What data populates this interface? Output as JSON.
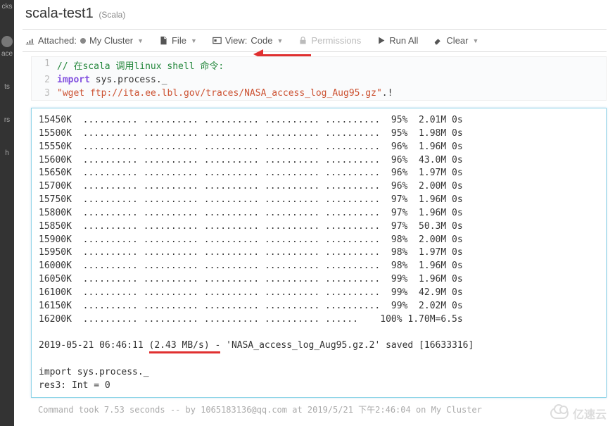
{
  "sidebar": {
    "items": [
      "cks",
      "",
      "ace",
      "ts",
      "",
      "rs",
      "h"
    ]
  },
  "header": {
    "title": "scala-test1",
    "language": "(Scala)"
  },
  "toolbar": {
    "attached": "Attached:",
    "cluster": "My Cluster",
    "file": "File",
    "view_label": "View:",
    "view_value": "Code",
    "permissions": "Permissions",
    "run_all": "Run All",
    "clear": "Clear"
  },
  "code": {
    "ln1": "1",
    "ln2": "2",
    "ln3": "3",
    "l1_comment": "// 在scala 调用linux shell 命令:",
    "l2_kw": "import",
    "l2_rest": " sys.process._",
    "l3_str": "\"wget ftp://ita.ee.lbl.gov/traces/NASA_access_log_Aug95.gz\"",
    "l3_op": ".!"
  },
  "output": {
    "rows": [
      [
        "15450K",
        ".......... .......... .......... .......... ..........",
        "95%",
        "2.01M",
        "0s"
      ],
      [
        "15500K",
        ".......... .......... .......... .......... ..........",
        "95%",
        "1.98M",
        "0s"
      ],
      [
        "15550K",
        ".......... .......... .......... .......... ..........",
        "96%",
        "1.96M",
        "0s"
      ],
      [
        "15600K",
        ".......... .......... .......... .......... ..........",
        "96%",
        "43.0M",
        "0s"
      ],
      [
        "15650K",
        ".......... .......... .......... .......... ..........",
        "96%",
        "1.97M",
        "0s"
      ],
      [
        "15700K",
        ".......... .......... .......... .......... ..........",
        "96%",
        "2.00M",
        "0s"
      ],
      [
        "15750K",
        ".......... .......... .......... .......... ..........",
        "97%",
        "1.96M",
        "0s"
      ],
      [
        "15800K",
        ".......... .......... .......... .......... ..........",
        "97%",
        "1.96M",
        "0s"
      ],
      [
        "15850K",
        ".......... .......... .......... .......... ..........",
        "97%",
        "50.3M",
        "0s"
      ],
      [
        "15900K",
        ".......... .......... .......... .......... ..........",
        "98%",
        "2.00M",
        "0s"
      ],
      [
        "15950K",
        ".......... .......... .......... .......... ..........",
        "98%",
        "1.97M",
        "0s"
      ],
      [
        "16000K",
        ".......... .......... .......... .......... ..........",
        "98%",
        "1.96M",
        "0s"
      ],
      [
        "16050K",
        ".......... .......... .......... .......... ..........",
        "99%",
        "1.96M",
        "0s"
      ],
      [
        "16100K",
        ".......... .......... .......... .......... ..........",
        "99%",
        "42.9M",
        "0s"
      ],
      [
        "16150K",
        ".......... .......... .......... .......... ..........",
        "99%",
        "2.02M",
        "0s"
      ],
      [
        "16200K",
        ".......... .......... .......... .......... ......   ",
        "100%",
        "1.70M=6.5s",
        ""
      ]
    ],
    "summary_prefix": "2019-05-21 06:46:11 ",
    "summary_speed": "(2.43 MB/s) -",
    "summary_suffix": " 'NASA_access_log_Aug95.gz.2' saved [16633316]",
    "post1": "import sys.process._",
    "post2": "res3: Int = 0"
  },
  "meta": "Command took 7.53 seconds -- by 1065183136@qq.com at 2019/5/21 下午2:46:04 on My Cluster",
  "watermark": "亿速云"
}
